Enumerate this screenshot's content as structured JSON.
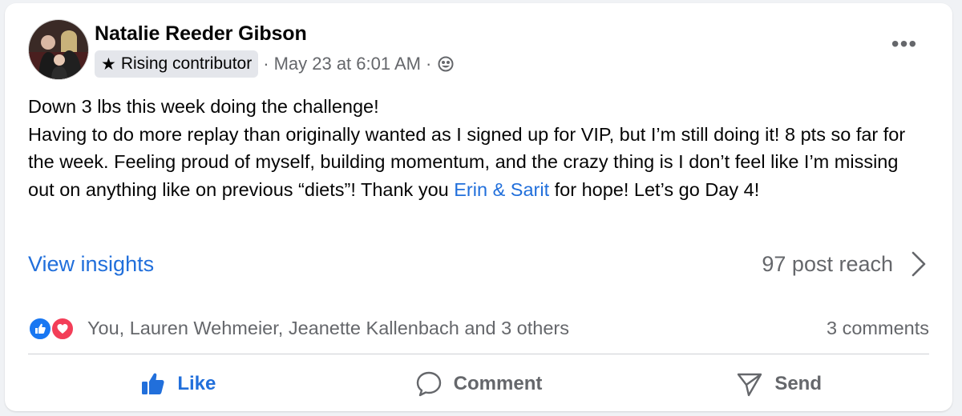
{
  "post": {
    "author": "Natalie Reeder Gibson",
    "badge": "Rising contributor",
    "separator1": "·",
    "timestamp": "May 23 at 6:01 AM",
    "separator2": "·",
    "audience_icon": "globe-icon",
    "more_icon": "more-options-icon",
    "more_label": "•••",
    "body": {
      "line1": "Down 3 lbs this week doing the challenge!",
      "line2_before_mention": "Having to do more replay than originally wanted as I signed up for VIP, but I’m still doing it! 8 pts so far for the week. Feeling proud of myself, building momentum, and the crazy thing is I don’t feel like I’m missing out on anything like on previous “diets”! Thank you ",
      "mention": "Erin & Sarit",
      "line2_after_mention": " for hope! Let’s go Day 4!"
    }
  },
  "insights": {
    "view_label": "View insights",
    "reach_label": "97 post reach",
    "chevron_icon": "chevron-right-icon"
  },
  "engagement": {
    "reaction_icons": [
      "like-reaction-icon",
      "love-reaction-icon"
    ],
    "reactors": "You, Lauren Wehmeier, Jeanette Kallenbach and 3 others",
    "comments": "3 comments"
  },
  "actions": {
    "like": "Like",
    "comment": "Comment",
    "send": "Send"
  },
  "colors": {
    "link_blue": "#216fdb",
    "secondary_text": "#65676b",
    "like_blue": "#1877f2",
    "love_red": "#f33e58",
    "badge_bg": "#e4e6eb"
  }
}
